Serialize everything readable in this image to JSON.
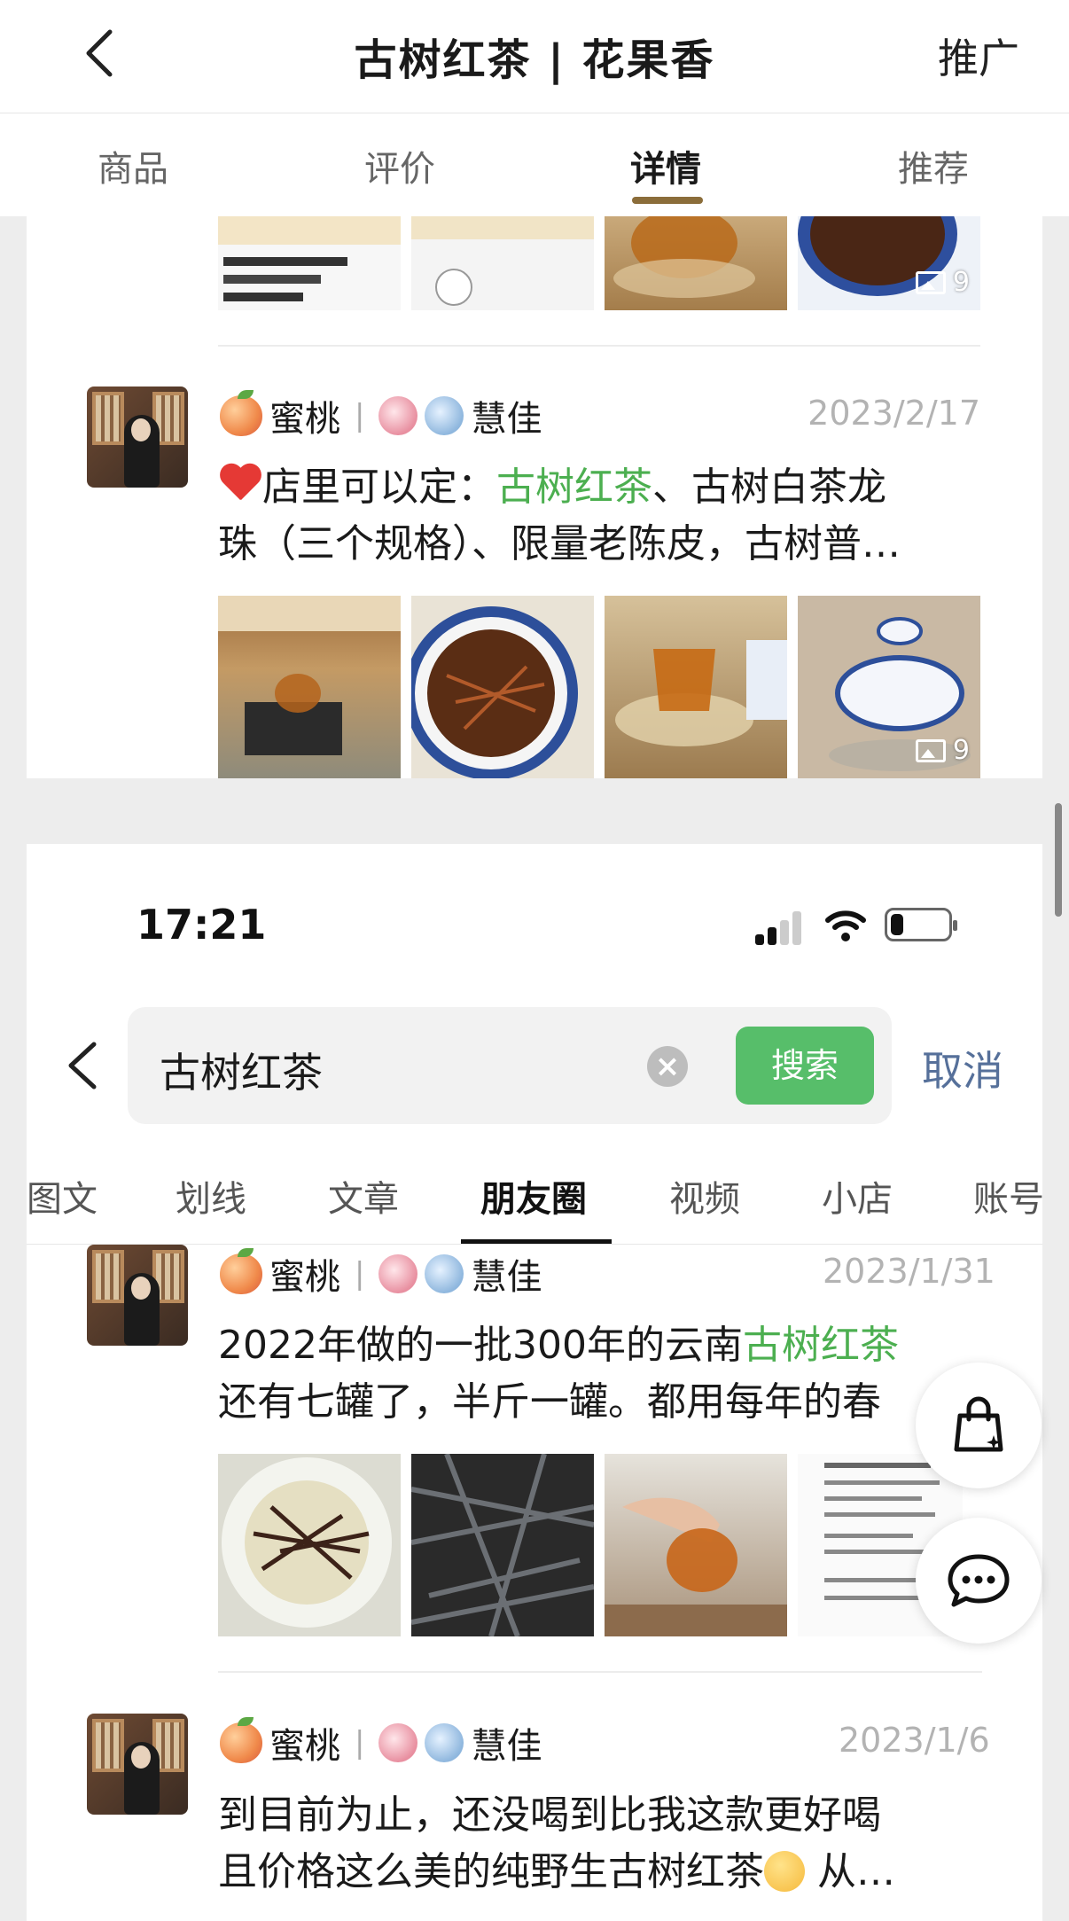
{
  "header": {
    "title": "古树红茶 | 花果香",
    "right_action": "推广"
  },
  "tabs": [
    {
      "label": "商品"
    },
    {
      "label": "评价"
    },
    {
      "label": "详情",
      "active": true
    },
    {
      "label": "推荐"
    }
  ],
  "top_card": {
    "first_gallery_count": "9",
    "post": {
      "author": {
        "name_a": "蜜桃",
        "separator": "|",
        "name_b": "慧佳"
      },
      "date": "2023/2/17",
      "line1_pre": "店里可以定：",
      "line1_highlight": "古树红茶",
      "line1_post": "、古树白茶龙",
      "line2": "珠（三个规格）、限量老陈皮，古树普…",
      "gallery_count": "9"
    }
  },
  "status_bar": {
    "time": "17:21"
  },
  "search": {
    "query": "古树红茶",
    "clear_label": "×",
    "button": "搜索",
    "cancel": "取消"
  },
  "search_tabs": [
    {
      "label": "图文"
    },
    {
      "label": "划线"
    },
    {
      "label": "文章"
    },
    {
      "label": "朋友圈",
      "active": true
    },
    {
      "label": "视频"
    },
    {
      "label": "小店"
    },
    {
      "label": "账号"
    }
  ],
  "moments": [
    {
      "author": {
        "name_a": "蜜桃",
        "separator": "|",
        "name_b": "慧佳"
      },
      "date": "2023/1/31",
      "line1_pre": "2022年做的一批300年的云南",
      "line1_highlight": "古树红茶",
      "line2": "还有七罐了，半斤一罐。都用每年的春"
    },
    {
      "author": {
        "name_a": "蜜桃",
        "separator": "|",
        "name_b": "慧佳"
      },
      "date": "2023/1/6",
      "line1": "到目前为止，还没喝到比我这款更好喝",
      "line2_pre": "且价格这么美的纯野生古树红茶",
      "line2_post": " 从…"
    }
  ],
  "colors": {
    "highlight": "#4caf50",
    "search_button": "#57be6a",
    "cancel": "#56709a",
    "tab_indicator": "#8b6d3a"
  },
  "icons": [
    "chevron-left-icon",
    "image-icon",
    "shopping-bag-icon",
    "chat-bubble-icon",
    "clear-icon",
    "signal-icon",
    "wifi-icon",
    "battery-icon"
  ]
}
